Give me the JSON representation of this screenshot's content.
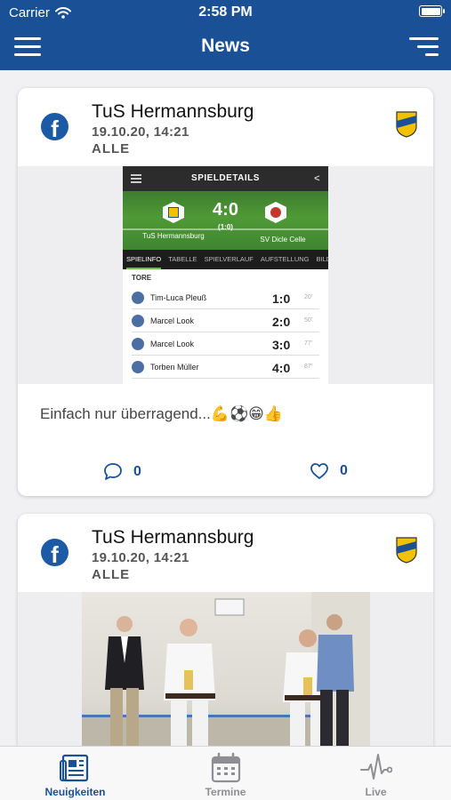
{
  "status": {
    "carrier": "Carrier",
    "time": "2:58 PM"
  },
  "nav": {
    "title": "News"
  },
  "posts": [
    {
      "author": "TuS Hermannsburg",
      "date": "19.10.20, 14:21",
      "audience": "ALLE",
      "source_icon": "facebook-icon",
      "text": "Einfach nur überragend...💪⚽😁👍",
      "comments": "0",
      "likes": "0",
      "embed": {
        "title": "SPIELDETAILS",
        "score": "4:0",
        "halftime": "(1:0)",
        "home": "TuS Hermannsburg",
        "away": "SV Dicle Celle",
        "tabs": [
          "SPIELINFO",
          "TABELLE",
          "SPIELVERLAUF",
          "AUFSTELLUNG",
          "BILDE"
        ],
        "section": "TORE",
        "goals": [
          {
            "player": "Tim-Luca Pleuß",
            "score": "1:0",
            "minute": "20'"
          },
          {
            "player": "Marcel Look",
            "score": "2:0",
            "minute": "50'"
          },
          {
            "player": "Marcel Look",
            "score": "3:0",
            "minute": "77'"
          },
          {
            "player": "Torben Müller",
            "score": "4:0",
            "minute": "87'"
          }
        ]
      }
    },
    {
      "author": "TuS Hermannsburg",
      "date": "19.10.20, 14:21",
      "audience": "ALLE",
      "source_icon": "facebook-icon"
    }
  ],
  "tabbar": {
    "items": [
      {
        "label": "Neuigkeiten",
        "icon": "newspaper-icon",
        "active": true
      },
      {
        "label": "Termine",
        "icon": "calendar-icon",
        "active": false
      },
      {
        "label": "Live",
        "icon": "pulse-icon",
        "active": false
      }
    ]
  },
  "colors": {
    "primary": "#1a5196",
    "inactive": "#8e8e93",
    "background": "#f1f1f3"
  }
}
